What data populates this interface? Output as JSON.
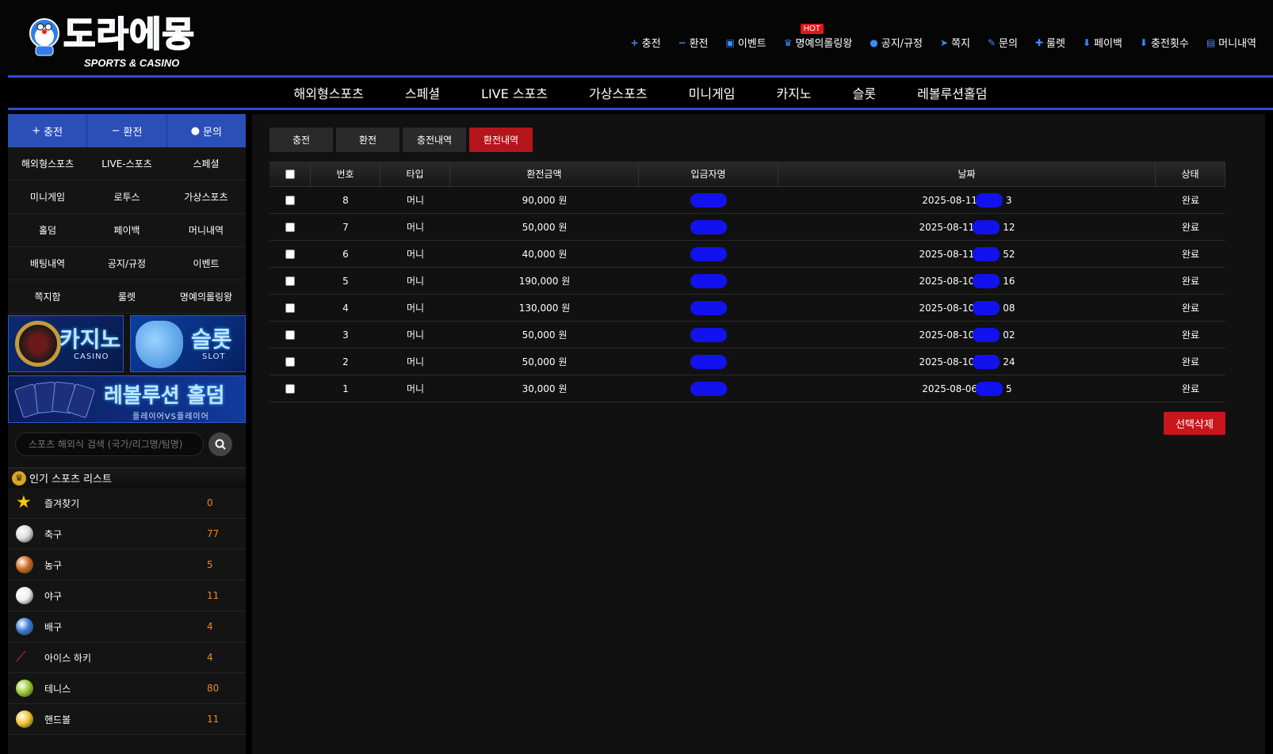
{
  "logo": {
    "title": "도라에몽",
    "subtitle": "SPORTS & CASINO"
  },
  "top_menu": [
    {
      "icon": "plus-icon",
      "glyph": "+",
      "label": "충전"
    },
    {
      "icon": "minus-icon",
      "glyph": "−",
      "label": "환전"
    },
    {
      "icon": "calendar-icon",
      "glyph": "▣",
      "label": "이벤트"
    },
    {
      "icon": "trophy-icon",
      "glyph": "♛",
      "label": "명예의롤링왕",
      "badge": "HOT"
    },
    {
      "icon": "info-icon",
      "glyph": "●",
      "label": "공지/규정"
    },
    {
      "icon": "paper-plane-icon",
      "glyph": "➤",
      "label": "쪽지"
    },
    {
      "icon": "edit-icon",
      "glyph": "✎",
      "label": "문의"
    },
    {
      "icon": "gift-icon",
      "glyph": "✚",
      "label": "룰렛"
    },
    {
      "icon": "payback-icon",
      "glyph": "⬇",
      "label": "페이백"
    },
    {
      "icon": "charge-count-icon",
      "glyph": "⬇",
      "label": "충전횟수"
    },
    {
      "icon": "clipboard-icon",
      "glyph": "▤",
      "label": "머니내역"
    }
  ],
  "main_nav": [
    "해외형스포츠",
    "스페셜",
    "LIVE 스포츠",
    "가상스포츠",
    "미니게임",
    "카지노",
    "슬롯",
    "레볼루션홀덤"
  ],
  "sidebar": {
    "quick": [
      {
        "glyph": "+",
        "label": "충전"
      },
      {
        "glyph": "−",
        "label": "환전"
      },
      {
        "glyph": "●",
        "label": "문의"
      }
    ],
    "grid": [
      "해외형스포츠",
      "LIVE-스포츠",
      "스페셜",
      "미니게임",
      "로투스",
      "가상스포츠",
      "홀덤",
      "페이백",
      "머니내역",
      "배팅내역",
      "공지/규정",
      "이벤트",
      "쪽지함",
      "룰렛",
      "명예의롤링왕"
    ],
    "banners": {
      "casino": {
        "title": "카지노",
        "sub": "CASINO"
      },
      "slot": {
        "title": "슬롯",
        "sub": "SLOT"
      },
      "holdem": {
        "title": "레볼루션 홀덤",
        "sub": "플레이어VS플레이어"
      }
    },
    "search_placeholder": "스포츠 해외식 검색 (국가/리그명/팀명)",
    "popular_title": "인기 스포츠 리스트",
    "sports": [
      {
        "name": "즐겨찾기",
        "count": "0",
        "icon": "star-icon",
        "color": "#f5c518"
      },
      {
        "name": "축구",
        "count": "77",
        "icon": "soccer-ball-icon",
        "color": "#dddddd"
      },
      {
        "name": "농구",
        "count": "5",
        "icon": "basketball-icon",
        "color": "#d2691e"
      },
      {
        "name": "야구",
        "count": "11",
        "icon": "baseball-icon",
        "color": "#f0f0f0"
      },
      {
        "name": "배구",
        "count": "4",
        "icon": "volleyball-icon",
        "color": "#3a7bd5"
      },
      {
        "name": "아이스 하키",
        "count": "4",
        "icon": "hockey-stick-icon",
        "color": "#c0392b"
      },
      {
        "name": "테니스",
        "count": "80",
        "icon": "tennis-ball-icon",
        "color": "#9acd32"
      },
      {
        "name": "핸드볼",
        "count": "11",
        "icon": "handball-icon",
        "color": "#f4c430"
      }
    ]
  },
  "content": {
    "tabs": [
      "충전",
      "환전",
      "충전내역",
      "환전내역"
    ],
    "active_tab": "환전내역",
    "columns": [
      "번호",
      "타입",
      "환전금액",
      "입금자명",
      "날짜",
      "상태"
    ],
    "rows": [
      {
        "no": "8",
        "type": "머니",
        "amount": "90,000 원",
        "date_prefix": "2025-08-11",
        "date_suffix": "3",
        "status": "완료"
      },
      {
        "no": "7",
        "type": "머니",
        "amount": "50,000 원",
        "date_prefix": "2025-08-11",
        "date_suffix": "12",
        "status": "완료"
      },
      {
        "no": "6",
        "type": "머니",
        "amount": "40,000 원",
        "date_prefix": "2025-08-11",
        "date_suffix": "52",
        "status": "완료"
      },
      {
        "no": "5",
        "type": "머니",
        "amount": "190,000 원",
        "date_prefix": "2025-08-10",
        "date_suffix": "16",
        "status": "완료"
      },
      {
        "no": "4",
        "type": "머니",
        "amount": "130,000 원",
        "date_prefix": "2025-08-10",
        "date_suffix": "08",
        "status": "완료"
      },
      {
        "no": "3",
        "type": "머니",
        "amount": "50,000 원",
        "date_prefix": "2025-08-10",
        "date_suffix": "02",
        "status": "완료"
      },
      {
        "no": "2",
        "type": "머니",
        "amount": "50,000 원",
        "date_prefix": "2025-08-10",
        "date_suffix": "24",
        "status": "완료"
      },
      {
        "no": "1",
        "type": "머니",
        "amount": "30,000 원",
        "date_prefix": "2025-08-06",
        "date_suffix": "5",
        "status": "완료"
      }
    ],
    "delete_button": "선택삭제"
  },
  "colors": {
    "accent_blue": "#2a4fd6",
    "active_red": "#b5161b",
    "count_orange": "#f08a1a",
    "redaction": "#1212ee"
  }
}
